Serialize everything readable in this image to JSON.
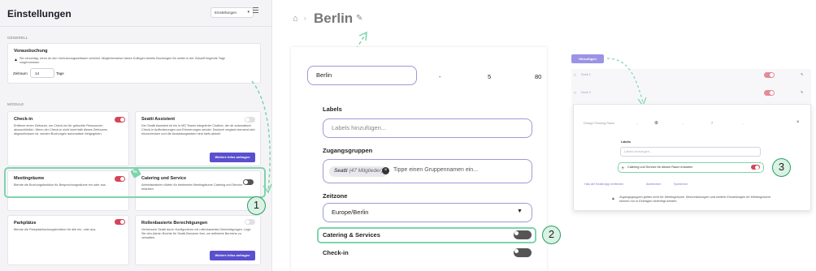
{
  "panel1": {
    "title": "Einstellungen",
    "dropdown_label": "Einstellungen",
    "section_general": "GENERELL",
    "vorausbuchung": {
      "title": "Vorausbuchung",
      "desc_line1": "Sie verschlag, wenn du den Vorbuchungszeitraum verkürzt. Möglicherweise haben Kollegen bereits Buchungen für weiter in der Zukunft liegende Tage",
      "desc_line2": "vorgenommen.",
      "zeitraum_label": "Zeitraum",
      "zeitraum_value": "14",
      "tage_label": "Tage"
    },
    "section_module": "MODULE",
    "checkin": {
      "title": "Check-in",
      "desc": "Entferne einen Zeitraum, um Check-ins für gebuchte Ressourcen abzuschließen. Wenn der Check-in nicht innerhalb dieses Zeitraums abgeschlossen ist, werden Buchungen automatisch freigegeben."
    },
    "seatti_assistent": {
      "title": "Seatti Assistent",
      "desc": "Der Seatti Assistent ist ein in MS Teams integrierter Chatbot, der dir automatisch Check-in Aufforderungen und Erinnerungen sendet. Dadurch vergisst niemand sich einzuchecken und die Auslastungsdaten sind stets aktuell.",
      "button": "Weitere Infos anfragen"
    },
    "meetingraeume": {
      "title": "Meetingräume",
      "desc": "Blende die Buchungsfunktion für Besprechungsräume ein oder aus."
    },
    "catering": {
      "title": "Catering und Service",
      "desc": "Administratoren dürfen für bestimmte Meetingräume Catering und Service erlauben."
    },
    "parkplaetze": {
      "title": "Parkplätze",
      "desc": "Blende die Parkplatzbuchungsfunktion für alle ein- oder aus."
    },
    "rollen": {
      "title": "Rollenbasierte Berechtigungen",
      "desc": "Verbessere Seatti durch Konfigurieren mit rollenbasierten Berechtigungen. Lege Sie den Admin-Rechte für Seatti-Benutzer fest, um definierte Bereiche zu verwalten.",
      "button": "Weitere Infos anfragen"
    },
    "badge": "1"
  },
  "panel2": {
    "breadcrumb": "Berlin",
    "name_value": "Berlin",
    "col_dash": "-",
    "col_five": "5",
    "col_eighty": "80",
    "labels_title": "Labels",
    "labels_placeholder": "Labels hinzufügen...",
    "groups_title": "Zugangsgruppen",
    "group_chip_name": "Seatti",
    "group_chip_count": "(47 Mitglieder)",
    "groups_placeholder": "Tippe einen Gruppennamen ein...",
    "timezone_title": "Zeitzone",
    "timezone_value": "Europe/Berlin",
    "catering_label": "Catering & Services",
    "checkin_label": "Check-in",
    "badge": "2"
  },
  "panel3": {
    "add_button": "Hinzufügen",
    "rows": [
      "Desk 1",
      "Desk 2"
    ],
    "dialog_name": "Design Thinking Raum",
    "dialog_dash1": "-",
    "dialog_seven": "7",
    "dialog_dash2": "-",
    "labels_title": "Labels",
    "labels_placeholder": "Labels hinzufügen...",
    "catering_text": "Catering und Service für diesen Raum erlauben",
    "cancel": "Abbrechen",
    "save": "Speichern",
    "link_text": "Has del Seatti App entfernen",
    "footer_note_line1": "Zugangsgruppen gelten nicht für Meetingräume. Beschränkungen und weitere Einstellungen für Meetingräume",
    "footer_note_line2": "können nur in Einträgen hinterlegt werden.",
    "badge": "3"
  },
  "colors": {
    "accent_purple": "#5a4fcf",
    "toggle_red": "#d74456",
    "highlight_green": "#7fd4ad",
    "badge_green": "#2a9d5c"
  }
}
